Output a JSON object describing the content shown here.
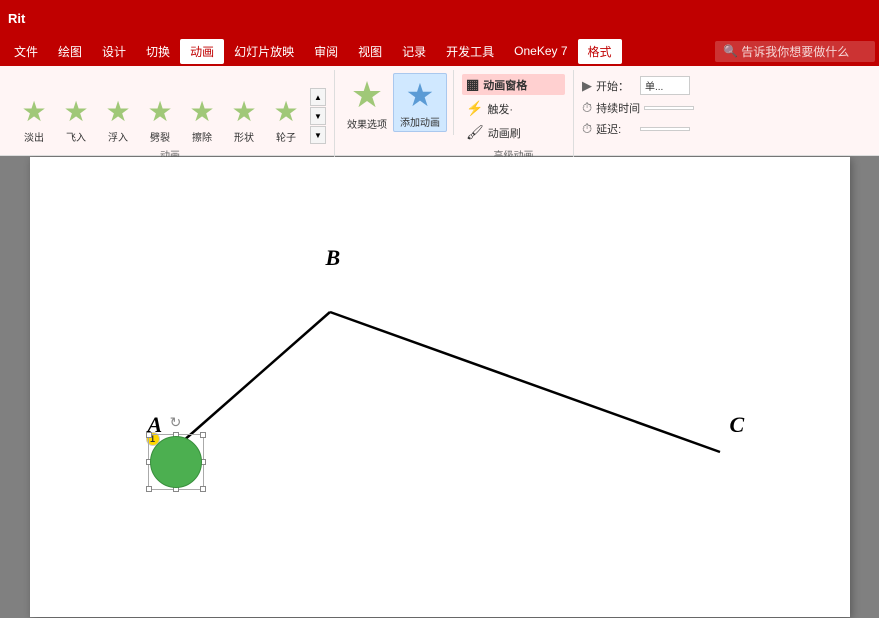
{
  "titlebar": {
    "text": "Rit"
  },
  "menubar": {
    "items": [
      {
        "label": "文件",
        "active": false
      },
      {
        "label": "绘图",
        "active": false
      },
      {
        "label": "设计",
        "active": false
      },
      {
        "label": "切换",
        "active": false
      },
      {
        "label": "动画",
        "active": true
      },
      {
        "label": "幻灯片放映",
        "active": false
      },
      {
        "label": "审阅",
        "active": false
      },
      {
        "label": "视图",
        "active": false
      },
      {
        "label": "记录",
        "active": false
      },
      {
        "label": "开发工具",
        "active": false
      },
      {
        "label": "OneKey 7",
        "active": false
      },
      {
        "label": "格式",
        "active": false,
        "format": true
      }
    ],
    "search": {
      "placeholder": "告诉我你想要做什么"
    }
  },
  "ribbon": {
    "animation_group": {
      "label": "动画",
      "items": [
        {
          "icon": "star",
          "label": "淡出"
        },
        {
          "icon": "star",
          "label": "飞入"
        },
        {
          "icon": "star",
          "label": "浮入"
        },
        {
          "icon": "star",
          "label": "劈裂"
        },
        {
          "icon": "star",
          "label": "擦除"
        },
        {
          "icon": "star",
          "label": "形状"
        },
        {
          "icon": "star",
          "label": "轮子"
        }
      ]
    },
    "effect_group": {
      "effect_options_label": "效果选项",
      "add_animation_label": "添加动画"
    },
    "advanced_group": {
      "label": "高级动画",
      "items": [
        {
          "label": "动画窗格",
          "active": true
        },
        {
          "label": "触发·"
        },
        {
          "label": "动画刷"
        }
      ]
    },
    "timing_group": {
      "label": "",
      "rows": [
        {
          "icon": "▶",
          "label": "开始：",
          "value": "单..."
        },
        {
          "icon": "⏱",
          "label": "持续时间"
        },
        {
          "icon": "⏱",
          "label": "延迟:"
        }
      ]
    }
  },
  "slide": {
    "label_b": "B",
    "label_a": "A",
    "label_c": "C"
  }
}
